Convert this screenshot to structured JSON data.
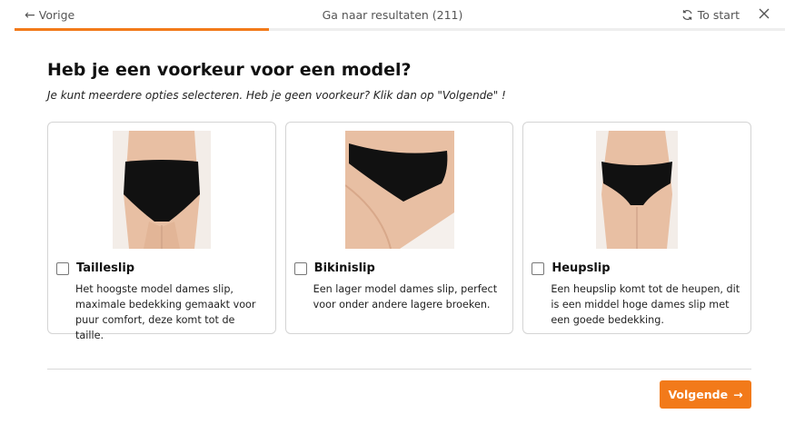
{
  "topbar": {
    "back_label": "Vorige",
    "results_label": "Ga naar resultaten (211)",
    "restart_label": "To start",
    "progress_fraction": 0.33
  },
  "question": {
    "title": "Heb je een voorkeur voor een model?",
    "subtitle": "Je kunt meerdere opties selecteren. Heb je geen voorkeur? Klik dan op \"Volgende\" !"
  },
  "options": [
    {
      "name": "Tailleslip",
      "description": "Het hoogste model dames slip, maximale bedekking gemaakt voor puur comfort, deze komt tot de taille.",
      "checked": false
    },
    {
      "name": "Bikinislip",
      "description": "Een lager model dames slip, perfect voor onder andere lagere broeken.",
      "checked": false
    },
    {
      "name": "Heupslip",
      "description": "Een heupslip komt tot de heupen, dit is een middel hoge dames slip met een goede bedekking.",
      "checked": false
    }
  ],
  "footer": {
    "next_label": "Volgende"
  },
  "colors": {
    "accent": "#f27a1a",
    "skin": "#e8bfa3",
    "garment": "#111111"
  }
}
